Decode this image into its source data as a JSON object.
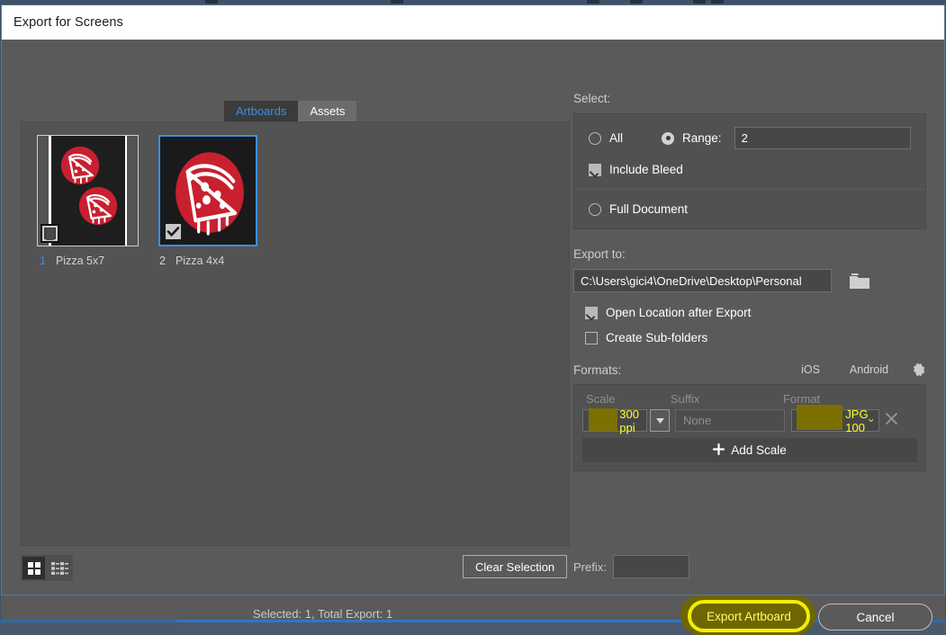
{
  "window": {
    "title": "Export for Screens"
  },
  "tabs": [
    {
      "label": "Artboards",
      "active": true
    },
    {
      "label": "Assets",
      "active": false
    }
  ],
  "artboards": {
    "items": [
      {
        "num": "1",
        "name": "Pizza 5x7",
        "checked": false,
        "selected": false
      },
      {
        "num": "2",
        "name": "Pizza 4x4",
        "checked": true,
        "selected": true
      }
    ]
  },
  "left_footer": {
    "grid_view_icon": "grid-view-icon",
    "list_view_icon": "list-view-icon",
    "clear_selection_label": "Clear Selection",
    "prefix_label": "Prefix:",
    "prefix_value": "",
    "status": "Selected: 1, Total Export: 1"
  },
  "select_section": {
    "label": "Select:",
    "all_label": "All",
    "all_selected": false,
    "range_label": "Range:",
    "range_selected": true,
    "range_value": "2",
    "include_bleed_label": "Include Bleed",
    "include_bleed_checked": true,
    "full_document_label": "Full Document",
    "full_document_selected": false
  },
  "export_to_section": {
    "label": "Export to:",
    "path": "C:\\Users\\gici4\\OneDrive\\Desktop\\Personal",
    "browse_icon": "folder-icon",
    "open_location_label": "Open Location after Export",
    "open_location_checked": true,
    "create_subfolders_label": "Create Sub-folders",
    "create_subfolders_checked": false
  },
  "formats_section": {
    "label": "Formats:",
    "presets": [
      "iOS",
      "Android"
    ],
    "settings_icon": "gear-icon",
    "columns": [
      "Scale",
      "Suffix",
      "Format"
    ],
    "rows": [
      {
        "scale": "300 ppi",
        "scale_highlighted": true,
        "suffix_placeholder": "None",
        "suffix_value": "",
        "format": "JPG 100",
        "format_highlighted": true,
        "remove_icon": "close-icon",
        "dropdown_icon": "chevron-down-icon"
      }
    ],
    "add_scale_label": "Add Scale",
    "add_icon": "plus-icon"
  },
  "footer": {
    "export_label": "Export Artboard",
    "export_highlighted": true,
    "cancel_label": "Cancel"
  },
  "colors": {
    "accent_blue": "#3c8fe0",
    "panel_bg": "#5a5a5a",
    "group_bg": "#515151",
    "highlight_yellow": "#f2ed05",
    "highlight_fill": "#7b7000",
    "pizza_red": "#c8202f"
  }
}
